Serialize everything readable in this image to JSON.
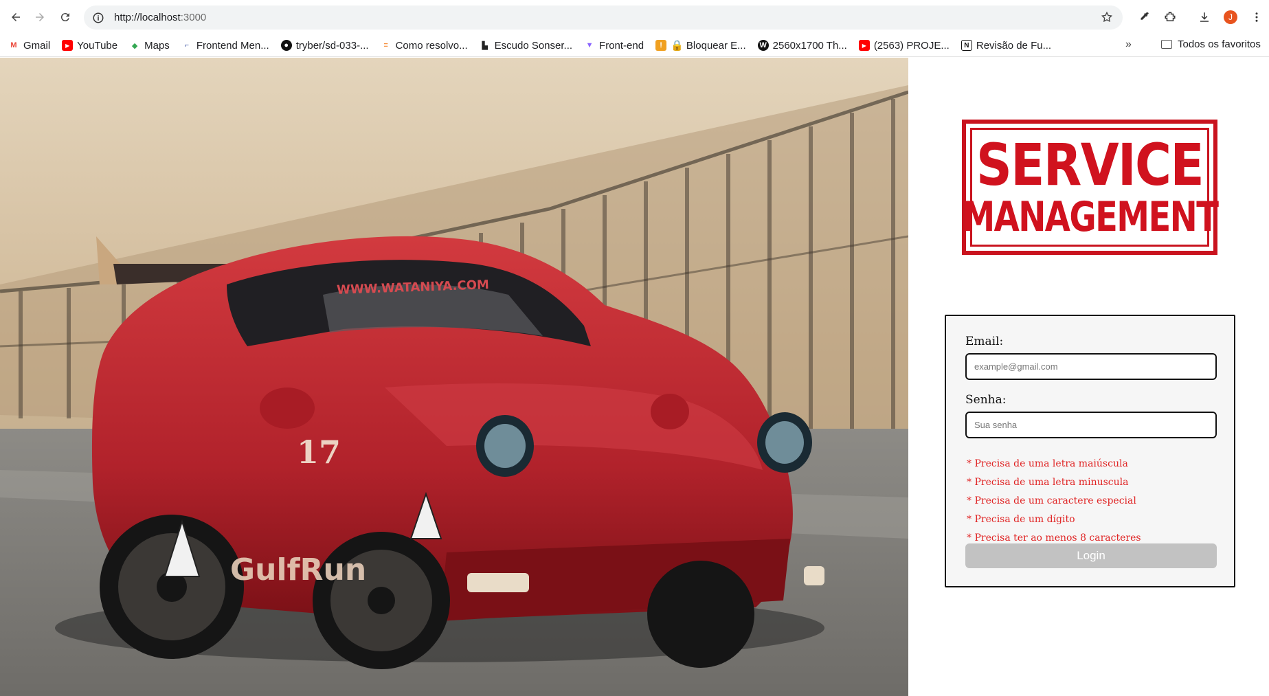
{
  "browser": {
    "url_host": "http://localhost",
    "url_port": ":3000",
    "profile_initial": "J",
    "bookmarks": [
      {
        "label": "Gmail",
        "icon": "gmail-icon",
        "color": "#ea4335"
      },
      {
        "label": "YouTube",
        "icon": "youtube-icon",
        "color": "#ff0000"
      },
      {
        "label": "Maps",
        "icon": "maps-icon",
        "color": "#34a853"
      },
      {
        "label": "Frontend Men...",
        "icon": "frontend-mentor-icon",
        "color": "#3e54a3"
      },
      {
        "label": "tryber/sd-033-...",
        "icon": "github-icon",
        "color": "#111111"
      },
      {
        "label": "Como resolvo...",
        "icon": "stackoverflow-icon",
        "color": "#f48024"
      },
      {
        "label": "Escudo Sonser...",
        "icon": "escudo-icon",
        "color": "#222222"
      },
      {
        "label": "Front-end",
        "icon": "vite-icon",
        "color": "#8a63ff"
      },
      {
        "label": "🔒 Bloquear E...",
        "icon": "extension-icon",
        "color": "#f0a020"
      },
      {
        "label": "2560x1700 Th...",
        "icon": "w-icon",
        "color": "#111111"
      },
      {
        "label": "(2563) PROJE...",
        "icon": "youtube-icon",
        "color": "#ff0000"
      },
      {
        "label": "Revisão de Fu...",
        "icon": "notion-icon",
        "color": "#111111"
      }
    ],
    "more_label": "»",
    "all_bookmarks_label": "Todos os favoritos"
  },
  "logo": {
    "line1": "SERVICE",
    "line2": "MANAGEMENT"
  },
  "form": {
    "email_label": "Email:",
    "email_placeholder": "example@gmail.com",
    "password_label": "Senha:",
    "password_placeholder": "Sua senha",
    "rules": [
      "* Precisa de uma letra maiúscula",
      "* Precisa de uma letra minuscula",
      "* Precisa de um caractere especial",
      "* Precisa de um dígito",
      "* Precisa ter ao menos 8 caracteres"
    ],
    "login_label": "Login"
  },
  "hero": {
    "car_color": "#b8222a",
    "windshield_text": "WWW.WATANIYA.COM",
    "door_number": "17",
    "door_logo": "GulfRun"
  }
}
